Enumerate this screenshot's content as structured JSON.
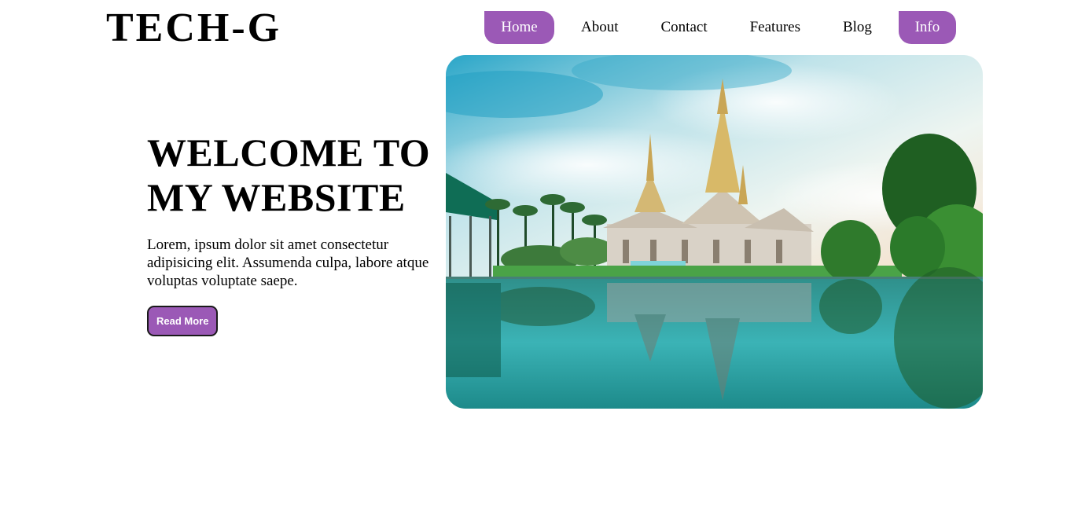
{
  "brand": {
    "logo": "TECH-G",
    "accent_color": "#9b59b6"
  },
  "nav": {
    "items": [
      {
        "label": "Home",
        "active": true
      },
      {
        "label": "About",
        "active": false
      },
      {
        "label": "Contact",
        "active": false
      },
      {
        "label": "Features",
        "active": false
      },
      {
        "label": "Blog",
        "active": false
      },
      {
        "label": "Info",
        "active": true
      }
    ]
  },
  "hero": {
    "title_line1": "WELCOME TO",
    "title_line2": "MY WEBSITE",
    "description": "Lorem, ipsum dolor sit amet consectetur adipisicing elit. Assumenda culpa, labore atque voluptas voluptate saepe.",
    "button_label": "Read More",
    "image": "temple-with-reflection-lake"
  }
}
